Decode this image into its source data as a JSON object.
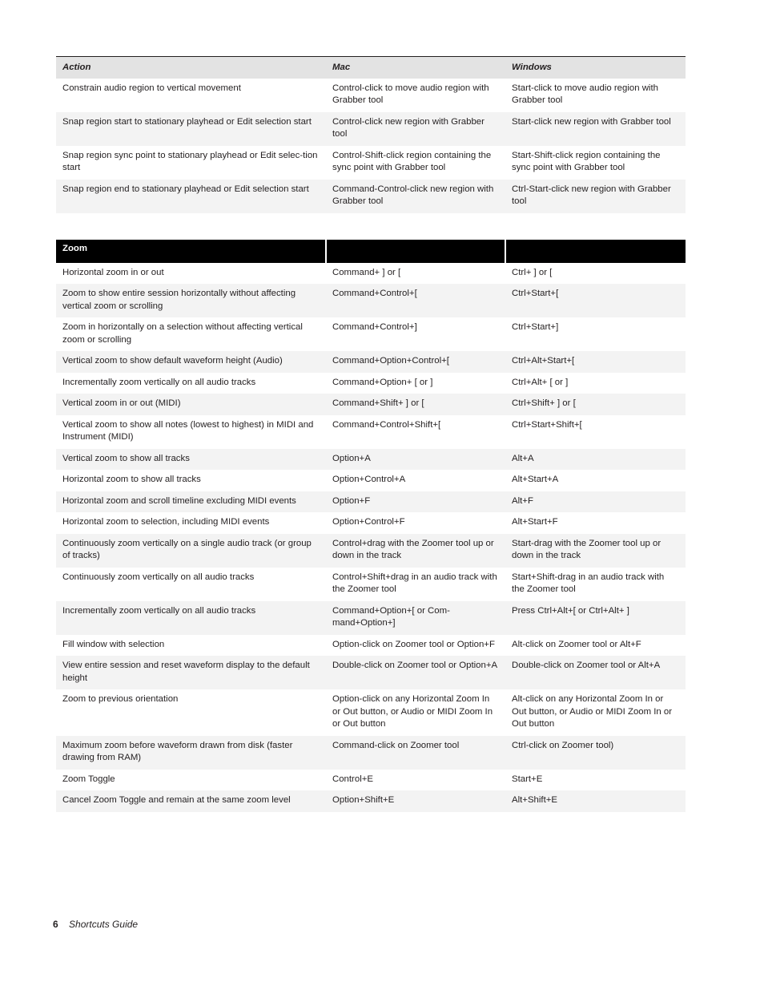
{
  "table1": {
    "headers": [
      "Action",
      "Mac",
      "Windows"
    ],
    "rows": [
      [
        "Constrain audio region to vertical movement",
        "Control-click to move audio region with Grabber tool",
        "Start-click to move audio region with Grabber tool"
      ],
      [
        "Snap region start to stationary playhead or Edit selection start",
        "Control-click new region with Grabber tool",
        "Start-click new region with Grabber tool"
      ],
      [
        "Snap region sync point to stationary playhead or Edit selec-tion start",
        "Control-Shift-click region containing the sync point with Grabber tool",
        "Start-Shift-click region containing the sync point with Grabber tool"
      ],
      [
        "Snap region end to stationary playhead or Edit selection start",
        "Command-Control-click new region with Grabber tool",
        "Ctrl-Start-click new region with Grabber tool"
      ]
    ]
  },
  "table2": {
    "headers": [
      "Zoom",
      "",
      ""
    ],
    "rows": [
      [
        "Horizontal zoom in or out",
        "Command+ ] or [",
        "Ctrl+ ] or ["
      ],
      [
        "Zoom to show entire session horizontally without affecting vertical zoom or scrolling",
        "Command+Control+[",
        "Ctrl+Start+["
      ],
      [
        "Zoom in horizontally on a selection without affecting vertical zoom or scrolling",
        "Command+Control+]",
        "Ctrl+Start+]"
      ],
      [
        "Vertical zoom to show default waveform height (Audio)",
        "Command+Option+Control+[",
        "Ctrl+Alt+Start+["
      ],
      [
        "Incrementally zoom vertically on all audio tracks",
        "Command+Option+ [ or ]",
        "Ctrl+Alt+ [ or ]"
      ],
      [
        "Vertical zoom in or out (MIDI)",
        "Command+Shift+ ] or [",
        "Ctrl+Shift+ ] or ["
      ],
      [
        "Vertical zoom to show all notes (lowest to highest) in MIDI and Instrument (MIDI)",
        "Command+Control+Shift+[",
        "Ctrl+Start+Shift+["
      ],
      [
        "Vertical zoom to show all tracks",
        "Option+A",
        "Alt+A"
      ],
      [
        "Horizontal zoom to show all tracks",
        "Option+Control+A",
        "Alt+Start+A"
      ],
      [
        "Horizontal zoom and scroll timeline excluding MIDI events",
        "Option+F",
        "Alt+F"
      ],
      [
        "Horizontal zoom to selection, including MIDI events",
        "Option+Control+F",
        "Alt+Start+F"
      ],
      [
        "Continuously zoom vertically on a single audio track (or group of tracks)",
        "Control+drag with the Zoomer tool up or down in the track",
        "Start-drag with the Zoomer tool up or down in the track"
      ],
      [
        "Continuously zoom vertically on all audio tracks",
        "Control+Shift+drag in an audio track with the Zoomer tool",
        "Start+Shift-drag in an audio track with the Zoomer tool"
      ],
      [
        "Incrementally zoom vertically on all audio tracks",
        "Command+Option+[ or Com-mand+Option+]",
        "Press Ctrl+Alt+[ or Ctrl+Alt+ ]"
      ],
      [
        "Fill window with selection",
        "Option-click on Zoomer tool or Option+F",
        "Alt-click on Zoomer tool or Alt+F"
      ],
      [
        "View entire session and reset waveform display to the default height",
        "Double-click on Zoomer tool or Option+A",
        "Double-click on Zoomer tool or Alt+A"
      ],
      [
        "Zoom to previous orientation",
        "Option-click on any Horizontal Zoom In or Out button, or Audio or MIDI Zoom In or Out button",
        "Alt-click on any Horizontal Zoom In or Out button, or Audio or MIDI Zoom In or Out button"
      ],
      [
        "Maximum zoom before waveform drawn from disk (faster drawing from RAM)",
        "Command-click on Zoomer tool",
        "Ctrl-click on Zoomer tool)"
      ],
      [
        "Zoom Toggle",
        "Control+E",
        "Start+E"
      ],
      [
        "Cancel Zoom Toggle and remain at the same zoom level",
        "Option+Shift+E",
        "Alt+Shift+E"
      ]
    ]
  },
  "footer": {
    "page_number": "6",
    "title": "Shortcuts Guide"
  }
}
